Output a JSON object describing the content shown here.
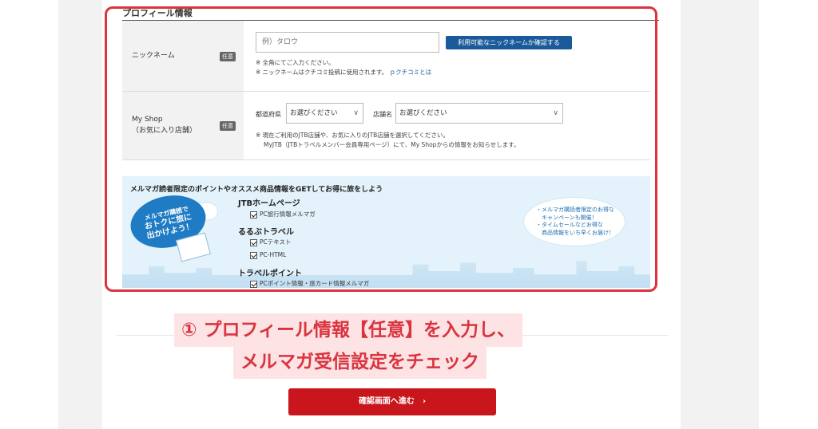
{
  "section_title": "プロフィール情報",
  "nickname": {
    "label": "ニックネーム",
    "badge": "任意",
    "placeholder": "例）タロウ",
    "check_button": "利用可能なニックネームか確認する",
    "note1": "※ 全角にてご入力ください。",
    "note2": "※ ニックネームはクチコミ投稿に使用されます。",
    "link": "クチコミとは"
  },
  "myshop": {
    "label_line1": "My Shop",
    "label_line2": "（お気に入り店舗）",
    "badge": "任意",
    "pref_label": "都道府県",
    "pref_value": "お選びください",
    "store_label": "店舗名",
    "store_value": "お選びください",
    "note1": "※ 現在ご利用のJTB店舗や、お気に入りのJTB店舗を選択してください。",
    "note2": "MyJTB（JTBトラベルメンバー会員専用ページ）にて、My Shopからの情報をお知らせします。"
  },
  "newsletter": {
    "heading": "メルマガ読者限定のポイントやオススメ商品情報をGETしてお得に旅をしよう",
    "bubble_left": [
      "メルマガ購読で",
      "おトクに旅に",
      "出かけよう！"
    ],
    "categories": [
      {
        "title": "JTBホームページ",
        "options": [
          "PC旅行情報メルマガ"
        ]
      },
      {
        "title": "るるぶトラベル",
        "options": [
          "PCテキスト",
          "PC-HTML"
        ]
      },
      {
        "title": "トラベルポイント",
        "options": [
          "PCポイント情報・旅カード情報メルマガ"
        ]
      }
    ],
    "bubble_right": [
      "・メルマガ購読者限定のお得な",
      "　キャンペーンも開催！",
      "・タイムセールなどお得な",
      "　商品情報をいち早くお届け！"
    ]
  },
  "caption": {
    "line1": "① プロフィール情報【任意】を入力し、",
    "line2": "メルマガ受信設定をチェック"
  },
  "confirm_button": "確認画面へ進む",
  "colors": {
    "accent_red": "#d9343f",
    "button_red": "#c9161d",
    "button_blue": "#1b5a9a"
  }
}
